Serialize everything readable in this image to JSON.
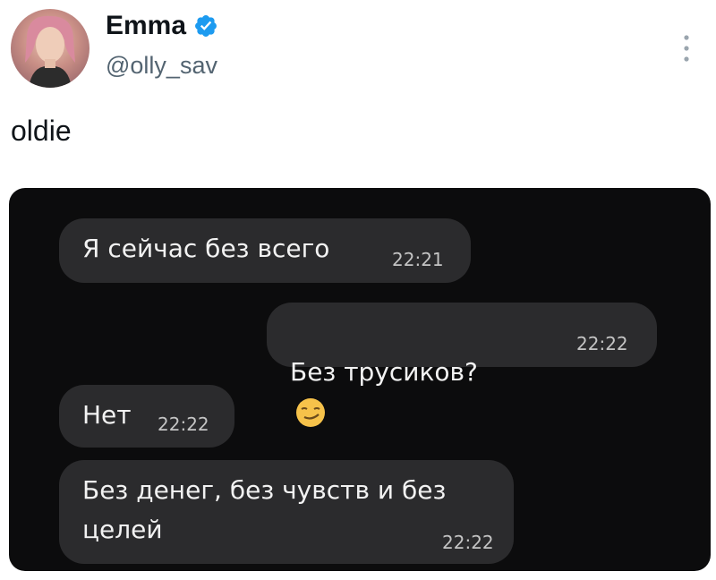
{
  "tweet": {
    "author": {
      "display_name": "Emma",
      "handle": "@olly_sav",
      "verified": true
    },
    "text": "oldie",
    "menu_icon": "more-vertical-icon"
  },
  "chat": {
    "messages": [
      {
        "side": "incoming",
        "text": "Я сейчас без всего",
        "time": "22:21"
      },
      {
        "side": "outgoing",
        "text": "Без трусиков?",
        "emoji": "smirking-face",
        "time": "22:22"
      },
      {
        "side": "incoming",
        "text": "Нет",
        "time": "22:22"
      },
      {
        "side": "incoming",
        "text": "Без денег, без чувств и без\nцелей",
        "time": "22:22"
      }
    ]
  },
  "colors": {
    "chat_background": "#0c0c0d",
    "bubble": "#2b2b2d",
    "verified_badge": "#1d9bf0",
    "handle_text": "#536471"
  }
}
